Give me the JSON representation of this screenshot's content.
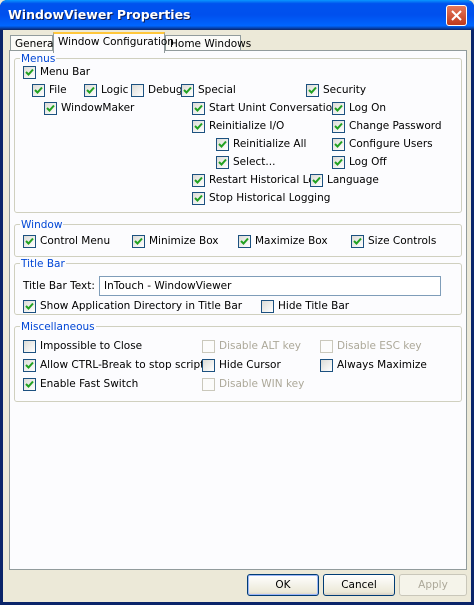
{
  "window": {
    "title": "WindowViewer Properties"
  },
  "tabs": [
    {
      "label": "General",
      "active": false
    },
    {
      "label": "Window Configuration",
      "active": true
    },
    {
      "label": "Home Windows",
      "active": false
    }
  ],
  "menus": {
    "label": "Menus",
    "menu_bar": {
      "label": "Menu Bar",
      "checked": true
    },
    "file": {
      "label": "File",
      "checked": true
    },
    "logic": {
      "label": "Logic",
      "checked": true
    },
    "debug": {
      "label": "Debug",
      "checked": false
    },
    "special": {
      "label": "Special",
      "checked": true
    },
    "security": {
      "label": "Security",
      "checked": true
    },
    "window_maker": {
      "label": "WindowMaker",
      "checked": true
    },
    "start_unint": {
      "label": "Start Unint Conversations",
      "checked": true
    },
    "reinit_io": {
      "label": "Reinitialize I/O",
      "checked": true
    },
    "reinit_all": {
      "label": "Reinitialize All",
      "checked": true
    },
    "select": {
      "label": "Select...",
      "checked": true
    },
    "restart_hist": {
      "label": "Restart Historical Log",
      "checked": true
    },
    "stop_hist": {
      "label": "Stop Historical Logging",
      "checked": true
    },
    "log_on": {
      "label": "Log On",
      "checked": true
    },
    "change_password": {
      "label": "Change Password",
      "checked": true
    },
    "configure_users": {
      "label": "Configure Users",
      "checked": true
    },
    "log_off": {
      "label": "Log Off",
      "checked": true
    },
    "language": {
      "label": "Language",
      "checked": true
    }
  },
  "window_group": {
    "label": "Window",
    "control_menu": {
      "label": "Control Menu",
      "checked": true
    },
    "minimize_box": {
      "label": "Minimize Box",
      "checked": true
    },
    "maximize_box": {
      "label": "Maximize Box",
      "checked": true
    },
    "size_controls": {
      "label": "Size Controls",
      "checked": true
    }
  },
  "title_bar": {
    "label": "Title Bar",
    "text_label": "Title Bar Text:",
    "text_value": "InTouch - WindowViewer",
    "show_app_dir": {
      "label": "Show Application Directory in Title Bar",
      "checked": true
    },
    "hide_title_bar": {
      "label": "Hide Title Bar",
      "checked": false
    }
  },
  "misc": {
    "label": "Miscellaneous",
    "impossible_close": {
      "label": "Impossible to Close",
      "checked": false
    },
    "allow_ctrl_break": {
      "label": "Allow CTRL-Break to stop scripts",
      "checked": true
    },
    "enable_fast_switch": {
      "label": "Enable Fast Switch",
      "checked": true
    },
    "disable_alt": {
      "label": "Disable ALT key",
      "checked": false,
      "disabled": true
    },
    "hide_cursor": {
      "label": "Hide Cursor",
      "checked": false
    },
    "disable_win": {
      "label": "Disable WIN key",
      "checked": false,
      "disabled": true
    },
    "disable_esc": {
      "label": "Disable ESC key",
      "checked": false,
      "disabled": true
    },
    "always_maximize": {
      "label": "Always Maximize",
      "checked": false
    }
  },
  "buttons": {
    "ok": "OK",
    "cancel": "Cancel",
    "apply": "Apply"
  },
  "icons": {
    "close": "close-icon",
    "check": "checkmark-icon"
  },
  "colors": {
    "title_blue": "#0050ee",
    "group_label": "#0046d5",
    "check_green": "#21a121",
    "tab_highlight": "#ffc73c"
  }
}
